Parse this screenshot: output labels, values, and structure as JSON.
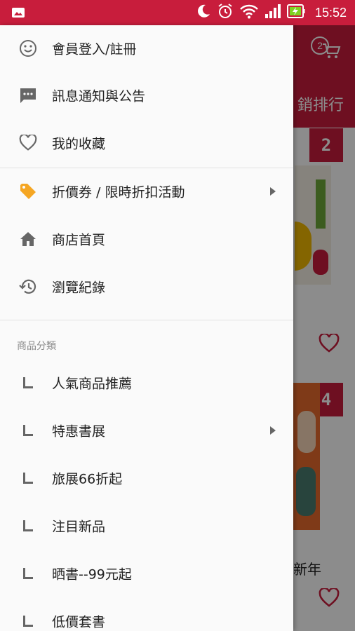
{
  "status_bar": {
    "time": "15:52",
    "icons": [
      "image-icon",
      "moon-icon",
      "alarm-icon",
      "wifi-icon",
      "signal-icon",
      "battery-charging-icon"
    ]
  },
  "background": {
    "cart_count": "2",
    "ranking_tab": "銷排行",
    "rank_badges": [
      "2",
      "4"
    ],
    "partial_book_title": "新年",
    "colors": {
      "header": "#c81d3c"
    }
  },
  "drawer": {
    "items": [
      {
        "label": "會員登入/註冊",
        "icon": "smiley-icon"
      },
      {
        "label": "訊息通知與公告",
        "icon": "message-icon"
      },
      {
        "label": "我的收藏",
        "icon": "heart-outline-icon"
      },
      {
        "label": "折價券 / 限時折扣活動",
        "icon": "tag-icon",
        "has_submenu": true
      },
      {
        "label": "商店首頁",
        "icon": "home-icon"
      },
      {
        "label": "瀏覽紀錄",
        "icon": "history-icon"
      }
    ],
    "category_section_title": "商品分類",
    "categories": [
      {
        "label": "人氣商品推薦",
        "has_submenu": false
      },
      {
        "label": "特惠書展",
        "has_submenu": true
      },
      {
        "label": "旅展66折起",
        "has_submenu": false
      },
      {
        "label": "注目新品",
        "has_submenu": false
      },
      {
        "label": "晒書--99元起",
        "has_submenu": false
      },
      {
        "label": "低價套書",
        "has_submenu": false
      }
    ],
    "colors": {
      "accent_tag": "#f5a623",
      "icon_gray": "#666666"
    }
  }
}
